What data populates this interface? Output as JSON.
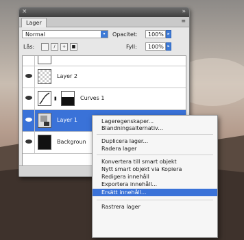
{
  "panel": {
    "tab_label": "Lager",
    "blend_mode": "Normal",
    "opacity_label": "Opacitet:",
    "opacity_value": "100%",
    "lock_label": "Lås:",
    "fill_label": "Fyll:",
    "fill_value": "100%"
  },
  "layers": [
    {
      "name": "Layer 2",
      "thumb": "checker",
      "visible": true,
      "selected": false
    },
    {
      "name": "Curves 1",
      "thumb": "curves",
      "visible": true,
      "selected": false
    },
    {
      "name": "Layer 1",
      "thumb": "smart-object",
      "visible": true,
      "selected": true
    },
    {
      "name": "Backgroun",
      "thumb": "dark",
      "visible": true,
      "selected": false
    }
  ],
  "context_menu": {
    "items": [
      "Lageregenskaper...",
      "Blandningsalternativ...",
      "Duplicera lager...",
      "Radera lager",
      "Konvertera till smart objekt",
      "Nytt smart objekt via Kopiera",
      "Redigera innehåll",
      "Exportera innehåll...",
      "Ersätt innehåll...",
      "Rastrera lager"
    ],
    "highlighted_index": 8
  },
  "colors": {
    "selection": "#3a72d8",
    "panel_bg": "#e7e7e7"
  }
}
